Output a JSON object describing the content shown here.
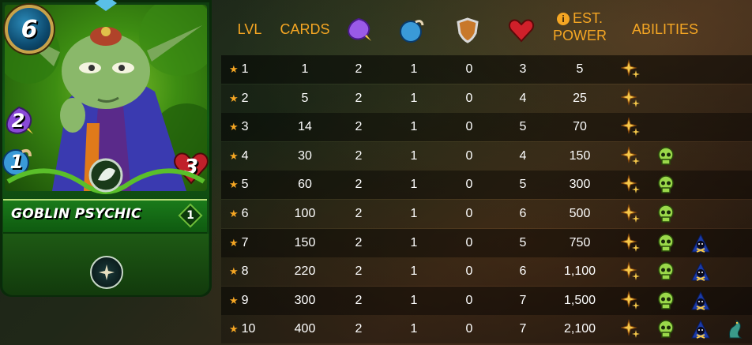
{
  "card": {
    "name": "Goblin Psychic",
    "mana": "6",
    "magic": "2",
    "speed": "1",
    "health": "3",
    "level": "1",
    "element": "earth",
    "ability_icon": "sparkle-icon"
  },
  "table": {
    "headers": {
      "lvl": "LVL",
      "cards": "CARDS",
      "magic": "magic-icon",
      "speed": "speed-icon",
      "armor": "armor-icon",
      "health": "health-icon",
      "est_line1": "EST.",
      "est_line2": "POWER",
      "abilities": "ABILITIES"
    },
    "rows": [
      {
        "lvl": "1",
        "cards": "1",
        "magic": "2",
        "speed": "1",
        "armor": "0",
        "health": "3",
        "power": "5",
        "abilities": [
          "sparkle-icon"
        ]
      },
      {
        "lvl": "2",
        "cards": "5",
        "magic": "2",
        "speed": "1",
        "armor": "0",
        "health": "4",
        "power": "25",
        "abilities": [
          "sparkle-icon"
        ]
      },
      {
        "lvl": "3",
        "cards": "14",
        "magic": "2",
        "speed": "1",
        "armor": "0",
        "health": "5",
        "power": "70",
        "abilities": [
          "sparkle-icon"
        ]
      },
      {
        "lvl": "4",
        "cards": "30",
        "magic": "2",
        "speed": "1",
        "armor": "0",
        "health": "4",
        "power": "150",
        "abilities": [
          "sparkle-icon",
          "skull-icon"
        ]
      },
      {
        "lvl": "5",
        "cards": "60",
        "magic": "2",
        "speed": "1",
        "armor": "0",
        "health": "5",
        "power": "300",
        "abilities": [
          "sparkle-icon",
          "skull-icon"
        ]
      },
      {
        "lvl": "6",
        "cards": "100",
        "magic": "2",
        "speed": "1",
        "armor": "0",
        "health": "6",
        "power": "500",
        "abilities": [
          "sparkle-icon",
          "skull-icon"
        ]
      },
      {
        "lvl": "7",
        "cards": "150",
        "magic": "2",
        "speed": "1",
        "armor": "0",
        "health": "5",
        "power": "750",
        "abilities": [
          "sparkle-icon",
          "skull-icon",
          "hooded-figure-icon"
        ]
      },
      {
        "lvl": "8",
        "cards": "220",
        "magic": "2",
        "speed": "1",
        "armor": "0",
        "health": "6",
        "power": "1,100",
        "abilities": [
          "sparkle-icon",
          "skull-icon",
          "hooded-figure-icon"
        ]
      },
      {
        "lvl": "9",
        "cards": "300",
        "magic": "2",
        "speed": "1",
        "armor": "0",
        "health": "7",
        "power": "1,500",
        "abilities": [
          "sparkle-icon",
          "skull-icon",
          "hooded-figure-icon"
        ]
      },
      {
        "lvl": "10",
        "cards": "400",
        "magic": "2",
        "speed": "1",
        "armor": "0",
        "health": "7",
        "power": "2,100",
        "abilities": [
          "sparkle-icon",
          "skull-icon",
          "hooded-figure-icon",
          "serpent-icon"
        ]
      }
    ]
  },
  "colors": {
    "header_text": "#f5a623",
    "star": "#f5a623",
    "card_green": "#125a14"
  }
}
